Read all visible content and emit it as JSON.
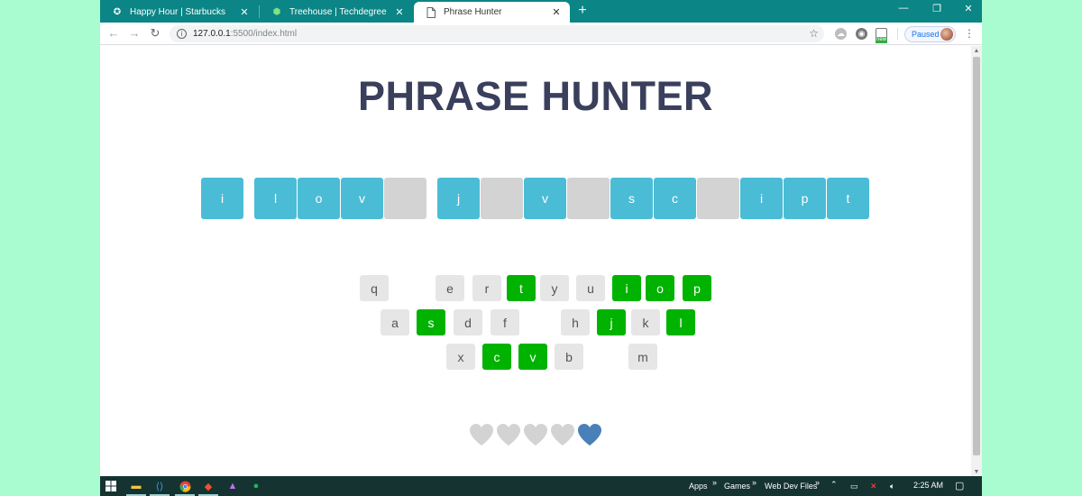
{
  "browser": {
    "tabs": [
      {
        "title": "Happy Hour | Starbucks",
        "icon": "starbucks-icon",
        "active": false
      },
      {
        "title": "Treehouse | Techdegree",
        "icon": "treehouse-icon",
        "active": false
      },
      {
        "title": "Phrase Hunter",
        "icon": "page-icon",
        "active": true
      }
    ],
    "new_tab_symbol": "+",
    "window_controls": {
      "minimize": "—",
      "restore": "❐",
      "close": "✕"
    },
    "url_host": "127.0.0.1",
    "url_path": ":5500/index.html",
    "profile_label": "Paused",
    "extension_badge": "new"
  },
  "game": {
    "title": "PHRASE HUNTER",
    "phrase": [
      {
        "letter": "i",
        "revealed": true
      },
      {
        "letter": "l",
        "revealed": true
      },
      {
        "letter": "o",
        "revealed": true
      },
      {
        "letter": "v",
        "revealed": true
      },
      {
        "letter": "",
        "revealed": false
      },
      {
        "letter": "j",
        "revealed": true
      },
      {
        "letter": "",
        "revealed": false
      },
      {
        "letter": "v",
        "revealed": true
      },
      {
        "letter": "",
        "revealed": false
      },
      {
        "letter": "s",
        "revealed": true
      },
      {
        "letter": "c",
        "revealed": true
      },
      {
        "letter": "",
        "revealed": false
      },
      {
        "letter": "i",
        "revealed": true
      },
      {
        "letter": "p",
        "revealed": true
      },
      {
        "letter": "t",
        "revealed": true
      }
    ],
    "keyboard": {
      "row1": [
        {
          "key": "q",
          "state": "unused"
        },
        {
          "key": "e",
          "state": "unused"
        },
        {
          "key": "r",
          "state": "unused"
        },
        {
          "key": "t",
          "state": "chosen"
        },
        {
          "key": "y",
          "state": "unused"
        },
        {
          "key": "u",
          "state": "unused"
        },
        {
          "key": "i",
          "state": "chosen"
        },
        {
          "key": "o",
          "state": "chosen"
        },
        {
          "key": "p",
          "state": "chosen"
        }
      ],
      "row2": [
        {
          "key": "a",
          "state": "unused"
        },
        {
          "key": "s",
          "state": "chosen"
        },
        {
          "key": "d",
          "state": "unused"
        },
        {
          "key": "f",
          "state": "unused"
        },
        {
          "key": "h",
          "state": "unused"
        },
        {
          "key": "j",
          "state": "chosen"
        },
        {
          "key": "k",
          "state": "unused"
        },
        {
          "key": "l",
          "state": "chosen"
        }
      ],
      "row3": [
        {
          "key": "x",
          "state": "unused"
        },
        {
          "key": "c",
          "state": "chosen"
        },
        {
          "key": "v",
          "state": "chosen"
        },
        {
          "key": "b",
          "state": "unused"
        },
        {
          "key": "m",
          "state": "unused"
        }
      ]
    },
    "hearts": {
      "lost": 4,
      "remaining": 1,
      "lost_color": "#d3d3d3",
      "remaining_color": "#4a80b8"
    },
    "colors": {
      "revealed": "#4bbcd6",
      "hidden": "#d3d3d3",
      "key_chosen": "#00b300",
      "key_unused": "#e6e6e6",
      "title": "#3a3f5c"
    }
  },
  "taskbar": {
    "toolbars": [
      "Apps",
      "Games",
      "Web Dev Files"
    ],
    "time": "2:25 AM"
  }
}
